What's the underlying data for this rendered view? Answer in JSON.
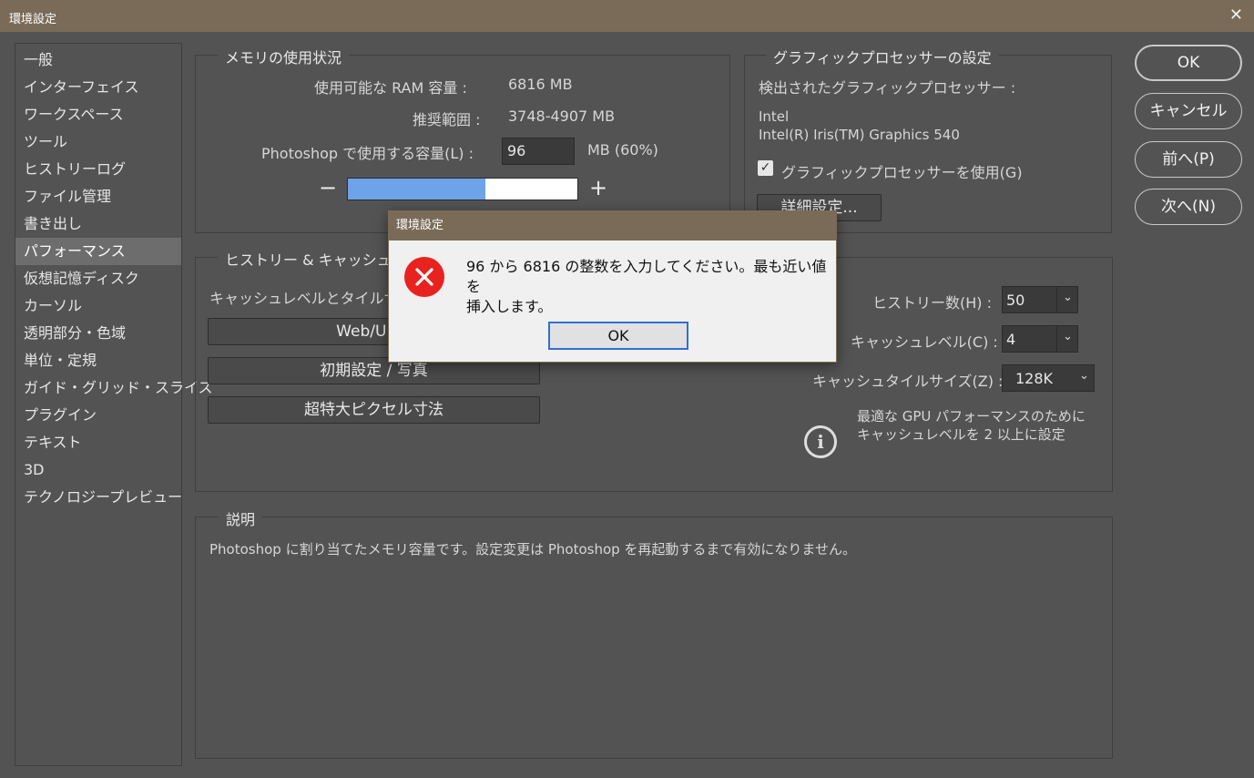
{
  "window": {
    "title": "環境設定",
    "close_glyph": "✕"
  },
  "sidebar": {
    "items": [
      {
        "label": "一般"
      },
      {
        "label": "インターフェイス"
      },
      {
        "label": "ワークスペース"
      },
      {
        "label": "ツール"
      },
      {
        "label": "ヒストリーログ"
      },
      {
        "label": "ファイル管理"
      },
      {
        "label": "書き出し"
      },
      {
        "label": "パフォーマンス",
        "selected": true
      },
      {
        "label": "仮想記憶ディスク"
      },
      {
        "label": "カーソル"
      },
      {
        "label": "透明部分・色域"
      },
      {
        "label": "単位・定規"
      },
      {
        "label": "ガイド・グリッド・スライス"
      },
      {
        "label": "プラグイン"
      },
      {
        "label": "テキスト"
      },
      {
        "label": "3D"
      },
      {
        "label": "テクノロジープレビュー"
      }
    ]
  },
  "memory": {
    "title": "メモリの使用状況",
    "available_label": "使用可能な RAM 容量 :",
    "available_value": "6816 MB",
    "range_label": "推奨範囲 :",
    "range_value": "3748-4907 MB",
    "use_label": "Photoshop で使用する容量(L) :",
    "use_value": "96",
    "use_unit": "MB (60%)",
    "slider_fraction": 0.6,
    "minus": "−",
    "plus": "+"
  },
  "gpu": {
    "title": "グラフィックプロセッサーの設定",
    "detected_label": "検出されたグラフィックプロセッサー :",
    "vendor": "Intel",
    "model": "Intel(R) Iris(TM) Graphics 540",
    "use_gpu_label": "グラフィックプロセッサーを使用(G)",
    "use_gpu_checked": true,
    "advanced_button": "詳細設定..."
  },
  "history_cache": {
    "title": "ヒストリー & キャッシュ",
    "intro": "キャッシュレベルとタイルサ",
    "preset_buttons": [
      "Web/UI デ",
      "初期設定 / 写真",
      "超特大ピクセル寸法"
    ],
    "history_states_label": "ヒストリー数(H) :",
    "history_states_value": "50",
    "cache_levels_label": "キャッシュレベル(C) :",
    "cache_levels_value": "4",
    "cache_tile_label": "キャッシュタイルサイズ(Z) :",
    "cache_tile_value": "128K",
    "tip_line1": "最適な GPU パフォーマンスのために",
    "tip_line2": "キャッシュレベルを 2 以上に設定"
  },
  "description": {
    "title": "説明",
    "text": "Photoshop に割り当てたメモリ容量です。設定変更は Photoshop を再起動するまで有効になりません。"
  },
  "actions": {
    "ok": "OK",
    "cancel": "キャンセル",
    "prev": "前へ(P)",
    "next": "次へ(N)"
  },
  "alert": {
    "title": "環境設定",
    "line1": "96 から 6816 の整数を入力してください。最も近い値を",
    "line2": "挿入します。",
    "ok": "OK"
  },
  "colors": {
    "title_bar": "#7a6b58",
    "panel": "#535353",
    "slider_fill": "#6ea3e9",
    "error_icon": "#e8231f",
    "focus": "#2f6fd6"
  }
}
